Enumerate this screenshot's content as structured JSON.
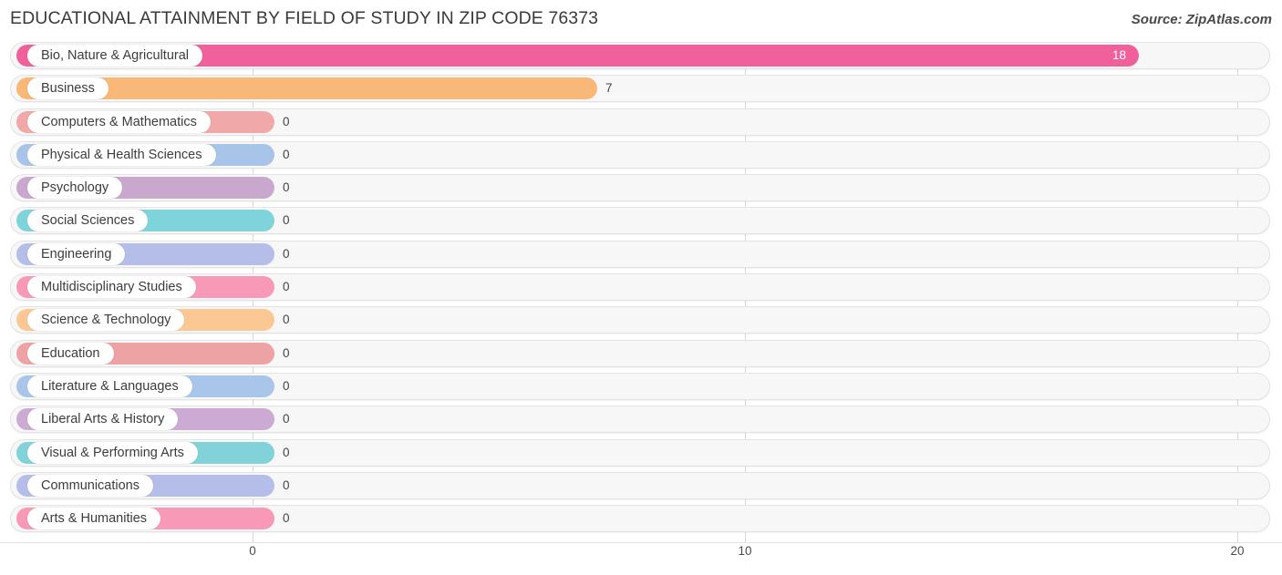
{
  "header": {
    "title": "EDUCATIONAL ATTAINMENT BY FIELD OF STUDY IN ZIP CODE 76373",
    "source": "Source: ZipAtlas.com"
  },
  "chart_data": {
    "type": "bar",
    "orientation": "horizontal",
    "title": "EDUCATIONAL ATTAINMENT BY FIELD OF STUDY IN ZIP CODE 76373",
    "xlabel": "",
    "ylabel": "",
    "xlim": [
      0,
      20
    ],
    "grid": true,
    "legend": "none",
    "xticks": [
      "0",
      "10",
      "20"
    ],
    "xtick_values": [
      0,
      10,
      20
    ],
    "categories": [
      "Bio, Nature & Agricultural",
      "Business",
      "Computers & Mathematics",
      "Physical & Health Sciences",
      "Psychology",
      "Social Sciences",
      "Engineering",
      "Multidisciplinary Studies",
      "Science & Technology",
      "Education",
      "Literature & Languages",
      "Liberal Arts & History",
      "Visual & Performing Arts",
      "Communications",
      "Arts & Humanities"
    ],
    "values": [
      18,
      7,
      0,
      0,
      0,
      0,
      0,
      0,
      0,
      0,
      0,
      0,
      0,
      0,
      0
    ],
    "value_labels": [
      "18",
      "7",
      "0",
      "0",
      "0",
      "0",
      "0",
      "0",
      "0",
      "0",
      "0",
      "0",
      "0",
      "0",
      "0"
    ],
    "colors": [
      "#f0609b",
      "#f9b878",
      "#f0a8a8",
      "#a8c4e8",
      "#c9a8cd",
      "#7fd4dc",
      "#b4bee8",
      "#f799b7",
      "#fbc894",
      "#eda3a3",
      "#a9c6ea",
      "#cbabd4",
      "#82d2da",
      "#b4bee8",
      "#f799b7"
    ]
  },
  "axis": {
    "ticks": [
      {
        "label": "0",
        "x": 277
      },
      {
        "label": "10",
        "x": 817
      },
      {
        "label": "20",
        "x": 1357
      }
    ]
  }
}
